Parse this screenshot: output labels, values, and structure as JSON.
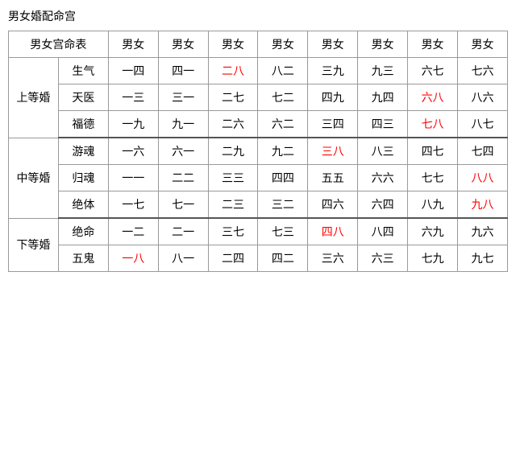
{
  "title": "男女婚配命宫",
  "table": {
    "header": {
      "col0": "男女宫命表",
      "cols": [
        "男女",
        "男女",
        "男女",
        "男女",
        "男女",
        "男女",
        "男女",
        "男女"
      ]
    },
    "sections": [
      {
        "category": "上等婚",
        "rows": [
          {
            "sub": "生气",
            "cells": [
              {
                "text": "一四",
                "red": false
              },
              {
                "text": "四一",
                "red": false
              },
              {
                "text": "二八",
                "red": true
              },
              {
                "text": "八二",
                "red": false
              },
              {
                "text": "三九",
                "red": false
              },
              {
                "text": "九三",
                "red": false
              },
              {
                "text": "六七",
                "red": false
              },
              {
                "text": "七六",
                "red": false
              }
            ]
          },
          {
            "sub": "天医",
            "cells": [
              {
                "text": "一三",
                "red": false
              },
              {
                "text": "三一",
                "red": false
              },
              {
                "text": "二七",
                "red": false
              },
              {
                "text": "七二",
                "red": false
              },
              {
                "text": "四九",
                "red": false
              },
              {
                "text": "九四",
                "red": false
              },
              {
                "text": "六八",
                "red": true
              },
              {
                "text": "八六",
                "red": false
              }
            ]
          },
          {
            "sub": "福德",
            "cells": [
              {
                "text": "一九",
                "red": false
              },
              {
                "text": "九一",
                "red": false
              },
              {
                "text": "二六",
                "red": false
              },
              {
                "text": "六二",
                "red": false
              },
              {
                "text": "三四",
                "red": false
              },
              {
                "text": "四三",
                "red": false
              },
              {
                "text": "七八",
                "red": true
              },
              {
                "text": "八七",
                "red": false
              }
            ]
          }
        ]
      },
      {
        "category": "中等婚",
        "rows": [
          {
            "sub": "游魂",
            "cells": [
              {
                "text": "一六",
                "red": false
              },
              {
                "text": "六一",
                "red": false
              },
              {
                "text": "二九",
                "red": false
              },
              {
                "text": "九二",
                "red": false
              },
              {
                "text": "三八",
                "red": true
              },
              {
                "text": "八三",
                "red": false
              },
              {
                "text": "四七",
                "red": false
              },
              {
                "text": "七四",
                "red": false
              }
            ]
          },
          {
            "sub": "归魂",
            "cells": [
              {
                "text": "一一",
                "red": false
              },
              {
                "text": "二二",
                "red": false
              },
              {
                "text": "三三",
                "red": false
              },
              {
                "text": "四四",
                "red": false
              },
              {
                "text": "五五",
                "red": false
              },
              {
                "text": "六六",
                "red": false
              },
              {
                "text": "七七",
                "red": false
              },
              {
                "text": "八八",
                "red": true
              }
            ]
          },
          {
            "sub": "绝体",
            "cells": [
              {
                "text": "一七",
                "red": false
              },
              {
                "text": "七一",
                "red": false
              },
              {
                "text": "二三",
                "red": false
              },
              {
                "text": "三二",
                "red": false
              },
              {
                "text": "四六",
                "red": false
              },
              {
                "text": "六四",
                "red": false
              },
              {
                "text": "八九",
                "red": false
              },
              {
                "text": "九八",
                "red": true
              }
            ]
          }
        ]
      },
      {
        "category": "下等婚",
        "rows": [
          {
            "sub": "绝命",
            "cells": [
              {
                "text": "一二",
                "red": false
              },
              {
                "text": "二一",
                "red": false
              },
              {
                "text": "三七",
                "red": false
              },
              {
                "text": "七三",
                "red": false
              },
              {
                "text": "四八",
                "red": true
              },
              {
                "text": "八四",
                "red": false
              },
              {
                "text": "六九",
                "red": false
              },
              {
                "text": "九六",
                "red": false
              }
            ]
          },
          {
            "sub": "五鬼",
            "cells": [
              {
                "text": "一八",
                "red": true
              },
              {
                "text": "八一",
                "red": false
              },
              {
                "text": "二四",
                "red": false
              },
              {
                "text": "四二",
                "red": false
              },
              {
                "text": "三六",
                "red": false
              },
              {
                "text": "六三",
                "red": false
              },
              {
                "text": "七九",
                "red": false
              },
              {
                "text": "九七",
                "red": false
              }
            ]
          }
        ]
      }
    ]
  }
}
